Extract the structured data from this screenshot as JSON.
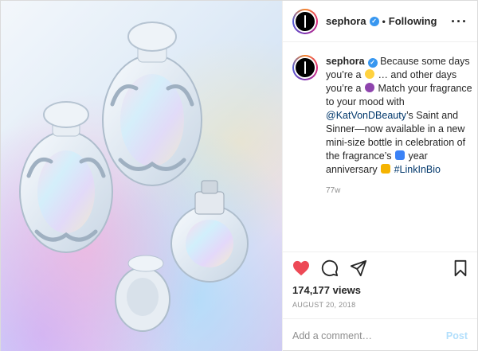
{
  "header": {
    "username": "sephora",
    "separator": "•",
    "follow_status": "Following",
    "more_label": "···"
  },
  "caption": {
    "username": "sephora",
    "text_1": "Because some days you’re a",
    "text_2": "… and other days you’re a",
    "text_3": "Match your fragrance to your mood with",
    "mention": "@KatVonDBeauty",
    "text_4": "’s Saint and Sinner—now available in a new mini-size bottle in celebration of the fragrance’s",
    "text_5": "year anniversary",
    "hashtag": "#LinkInBio",
    "time": "77w",
    "emojis": [
      "angel-face",
      "devil-face",
      "number-one",
      "party-popper"
    ]
  },
  "actions": {
    "views": "174,177 views",
    "date": "AUGUST 20, 2018",
    "liked_color": "#ed4956"
  },
  "add_comment": {
    "placeholder": "Add a comment…",
    "post_label": "Post"
  },
  "colors": {
    "verified": "#3897f0",
    "link": "#00376b",
    "muted": "#8e8e8e"
  }
}
